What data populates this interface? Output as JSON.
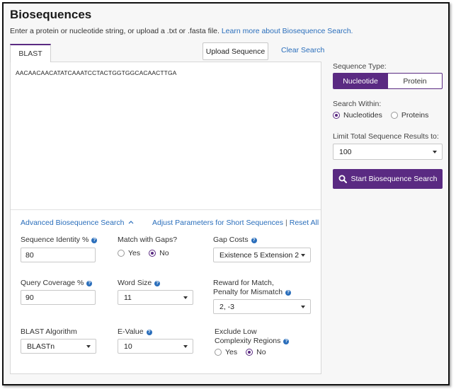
{
  "header": {
    "title": "Biosequences",
    "subtitle": "Enter a protein or nucleotide string, or upload a .txt or .fasta file.",
    "learn_more_link": "Learn more about Biosequence Search."
  },
  "tabs": [
    {
      "label": "BLAST",
      "active": true
    }
  ],
  "toolbar": {
    "upload_label": "Upload Sequence",
    "clear_label": "Clear Search"
  },
  "editor": {
    "sequence": "AACAACAACATATCAAATCCTACTGGTGGCACAACTTGA"
  },
  "advanced": {
    "toggle_label": "Advanced Biosequence Search",
    "adjust_label": "Adjust Parameters for Short Sequences",
    "separator": "|",
    "reset_label": "Reset All",
    "sequence_identity": {
      "label": "Sequence Identity %",
      "value": "80"
    },
    "match_with_gaps": {
      "label": "Match with Gaps?",
      "yes": "Yes",
      "no": "No",
      "selected": "No"
    },
    "gap_costs": {
      "label": "Gap Costs",
      "value": "Existence 5 Extension 2"
    },
    "query_coverage": {
      "label": "Query Coverage %",
      "value": "90"
    },
    "word_size": {
      "label": "Word Size",
      "value": "11"
    },
    "reward_penalty": {
      "label_line1": "Reward for Match,",
      "label_line2": "Penalty for Mismatch",
      "value": "2, -3"
    },
    "blast_algorithm": {
      "label": "BLAST Algorithm",
      "value": "BLASTn"
    },
    "e_value": {
      "label": "E-Value",
      "value": "10"
    },
    "low_complexity": {
      "label_line1": "Exclude Low",
      "label_line2": "Complexity Regions",
      "yes": "Yes",
      "no": "No",
      "selected": "No"
    }
  },
  "sidebar": {
    "sequence_type_label": "Sequence Type:",
    "type_options": [
      "Nucleotide",
      "Protein"
    ],
    "type_selected": "Nucleotide",
    "search_within_label": "Search Within:",
    "within_options": [
      "Nucleotides",
      "Proteins"
    ],
    "within_selected": "Nucleotides",
    "limit_label": "Limit Total Sequence Results to:",
    "limit_value": "100",
    "start_label": "Start Biosequence Search"
  },
  "colors": {
    "accent": "#5a2a82",
    "link": "#2a6ebb"
  },
  "icons": {
    "help": "question-circle-icon",
    "search": "search-icon",
    "dropdown": "chevron-down-icon",
    "collapse": "chevron-up-icon"
  }
}
